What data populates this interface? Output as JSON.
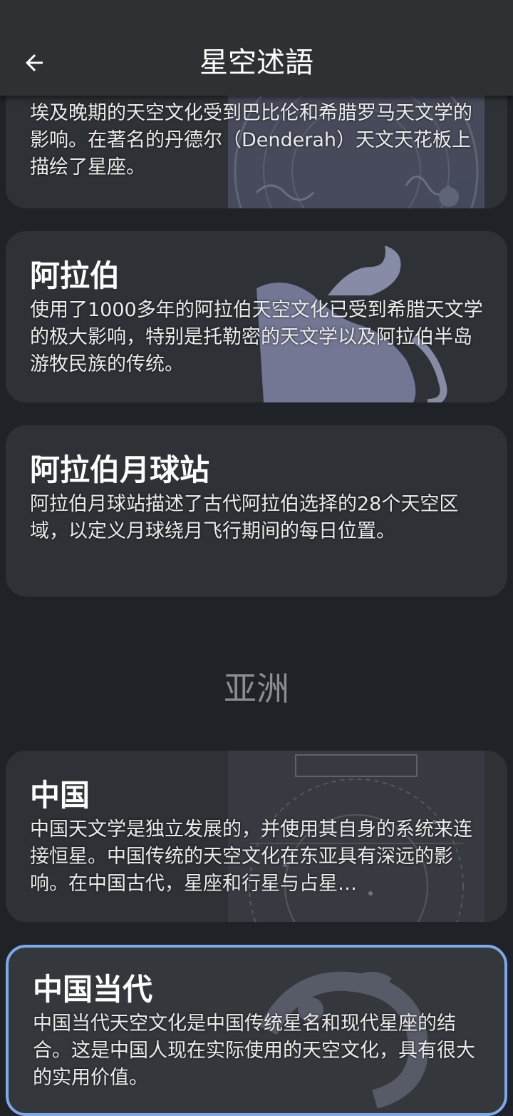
{
  "header": {
    "title": "星空述語"
  },
  "cards_top": [
    {
      "title": "",
      "desc": "埃及晚期的天空文化受到巴比伦和希腊罗马天文学的影响。在著名的丹德尔（Denderah）天文天花板上描绘了星座。"
    },
    {
      "title": "阿拉伯",
      "desc": "使用了1000多年的阿拉伯天空文化已受到希腊天文学的极大影响，特别是托勒密的天文学以及阿拉伯半岛游牧民族的传统。"
    },
    {
      "title": "阿拉伯月球站",
      "desc": "阿拉伯月球站描述了古代阿拉伯选择的28个天空区域，以定义月球绕月飞行期间的每日位置。"
    }
  ],
  "section": {
    "asia": "亚洲"
  },
  "cards_asia": [
    {
      "title": "中国",
      "desc": "中国天文学是独立发展的，并使用其自身的系统来连接恒星。中国传统的天空文化在东亚具有深远的影响。在中国古代，星座和行星与占星…"
    },
    {
      "title": "中国当代",
      "desc": "中国当代天空文化是中国传统星名和现代星座的结合。这是中国人现在实际使用的天空文化，具有很大的实用价值。"
    }
  ],
  "colors": {
    "accent": "#7fa8e8",
    "card": "#2e3136",
    "background": "#1f2226",
    "topbar": "#2e3034"
  },
  "icons": {
    "back": "arrow-left-icon"
  }
}
